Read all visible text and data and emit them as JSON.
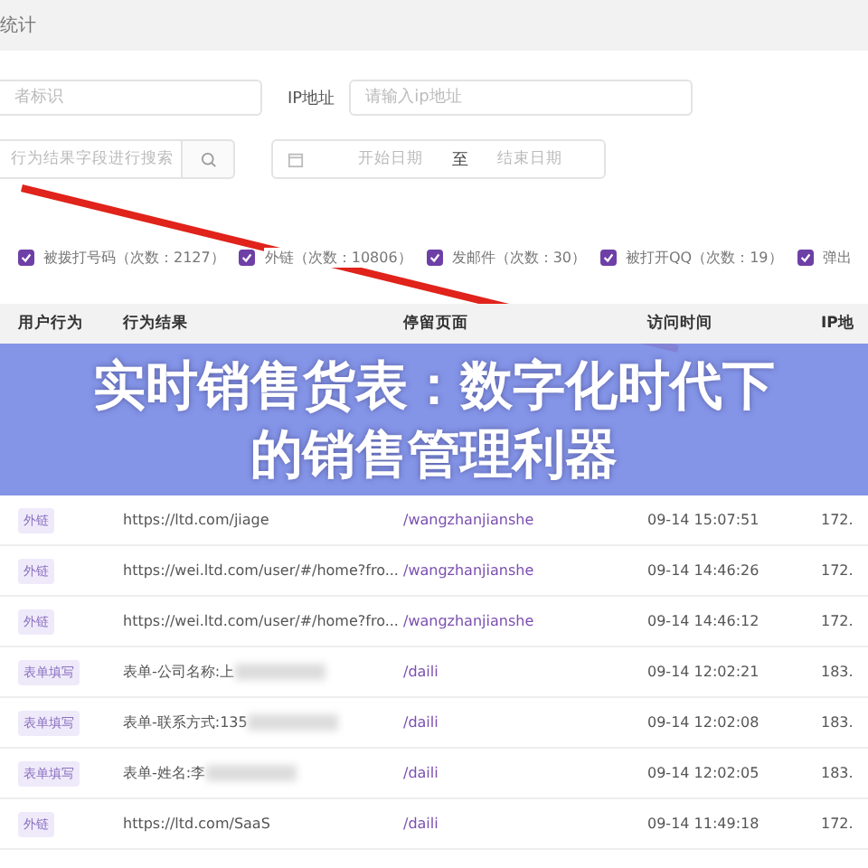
{
  "header": {
    "title": "统计"
  },
  "filters": {
    "user_field": {
      "placeholder": "者标识"
    },
    "ip_label": "IP地址",
    "ip_field": {
      "placeholder": "请输入ip地址"
    },
    "search_field": {
      "placeholder": "行为结果字段进行搜索"
    },
    "date_start": {
      "placeholder": "开始日期"
    },
    "date_sep": "至",
    "date_end": {
      "placeholder": "结束日期"
    }
  },
  "behaviors": [
    {
      "label": "被拨打号码（次数：2127）",
      "checked": true
    },
    {
      "label": "外链（次数：10806）",
      "checked": true
    },
    {
      "label": "发邮件（次数：30）",
      "checked": true
    },
    {
      "label": "被打开QQ（次数：19）",
      "checked": true
    },
    {
      "label": "弹出",
      "checked": true
    }
  ],
  "table": {
    "columns": [
      "用户行为",
      "行为结果",
      "停留页面",
      "访问时间",
      "IP地"
    ],
    "rows": [
      {
        "action": "外链",
        "result": "https://ltd.com/jiage",
        "page": "/wangzhanjianshe",
        "time": "09-14 15:07:51",
        "ip": "172."
      },
      {
        "action": "外链",
        "result": "https://wei.ltd.com/user/#/home?fro...",
        "page": "/wangzhanjianshe",
        "time": "09-14 14:46:26",
        "ip": "172."
      },
      {
        "action": "外链",
        "result": "https://wei.ltd.com/user/#/home?fro...",
        "page": "/wangzhanjianshe",
        "time": "09-14 14:46:12",
        "ip": "172."
      },
      {
        "action": "表单填写",
        "result": "表单-公司名称:上",
        "blurred": true,
        "page": "/daili",
        "time": "09-14 12:02:21",
        "ip": "183."
      },
      {
        "action": "表单填写",
        "result": "表单-联系方式:135",
        "blurred": true,
        "page": "/daili",
        "time": "09-14 12:02:08",
        "ip": "183."
      },
      {
        "action": "表单填写",
        "result": "表单-姓名:李",
        "blurred": true,
        "page": "/daili",
        "time": "09-14 12:02:05",
        "ip": "183."
      },
      {
        "action": "外链",
        "result": "https://ltd.com/SaaS",
        "page": "/daili",
        "time": "09-14 11:49:18",
        "ip": "172."
      }
    ]
  },
  "banner": {
    "title": "实时销售货表：数字化时代下的销售管理利器"
  }
}
